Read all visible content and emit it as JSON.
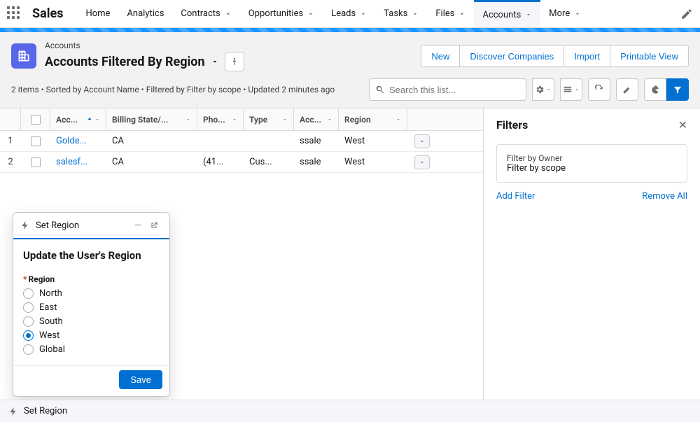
{
  "app": {
    "name": "Sales"
  },
  "nav": {
    "items": [
      {
        "label": "Home",
        "dropdown": false
      },
      {
        "label": "Analytics",
        "dropdown": false
      },
      {
        "label": "Contracts",
        "dropdown": true
      },
      {
        "label": "Opportunities",
        "dropdown": true
      },
      {
        "label": "Leads",
        "dropdown": true
      },
      {
        "label": "Tasks",
        "dropdown": true
      },
      {
        "label": "Files",
        "dropdown": true
      },
      {
        "label": "Accounts",
        "dropdown": true,
        "active": true
      },
      {
        "label": "More",
        "dropdown": true
      }
    ]
  },
  "header": {
    "object_label": "Accounts",
    "view_name": "Accounts Filtered By Region",
    "actions": {
      "new": "New",
      "discover": "Discover Companies",
      "import": "Import",
      "print": "Printable View"
    },
    "meta": "2 items • Sorted by Account Name • Filtered by Filter by scope • Updated 2 minutes ago",
    "search_placeholder": "Search this list..."
  },
  "table": {
    "columns": {
      "name": "Acc...",
      "state": "Billing State/...",
      "phone": "Pho...",
      "type": "Type",
      "accsite": "Acc...",
      "region": "Region"
    },
    "rows": [
      {
        "num": "1",
        "name": "Golde...",
        "state": "CA",
        "phone": "",
        "type": "",
        "accsite": "ssale",
        "region": "West"
      },
      {
        "num": "2",
        "name": "salesf...",
        "state": "CA",
        "phone": "(41...",
        "type": "Cus...",
        "accsite": "ssale",
        "region": "West"
      }
    ]
  },
  "filters": {
    "title": "Filters",
    "owner_label": "Filter by Owner",
    "owner_value": "Filter by scope",
    "add": "Add Filter",
    "remove_all": "Remove All"
  },
  "modal": {
    "header": "Set Region",
    "title": "Update the User's Region",
    "field_label": "Region",
    "options": [
      "North",
      "East",
      "South",
      "West",
      "Global"
    ],
    "selected": "West",
    "save": "Save"
  },
  "utilbar": {
    "label": "Set Region"
  }
}
